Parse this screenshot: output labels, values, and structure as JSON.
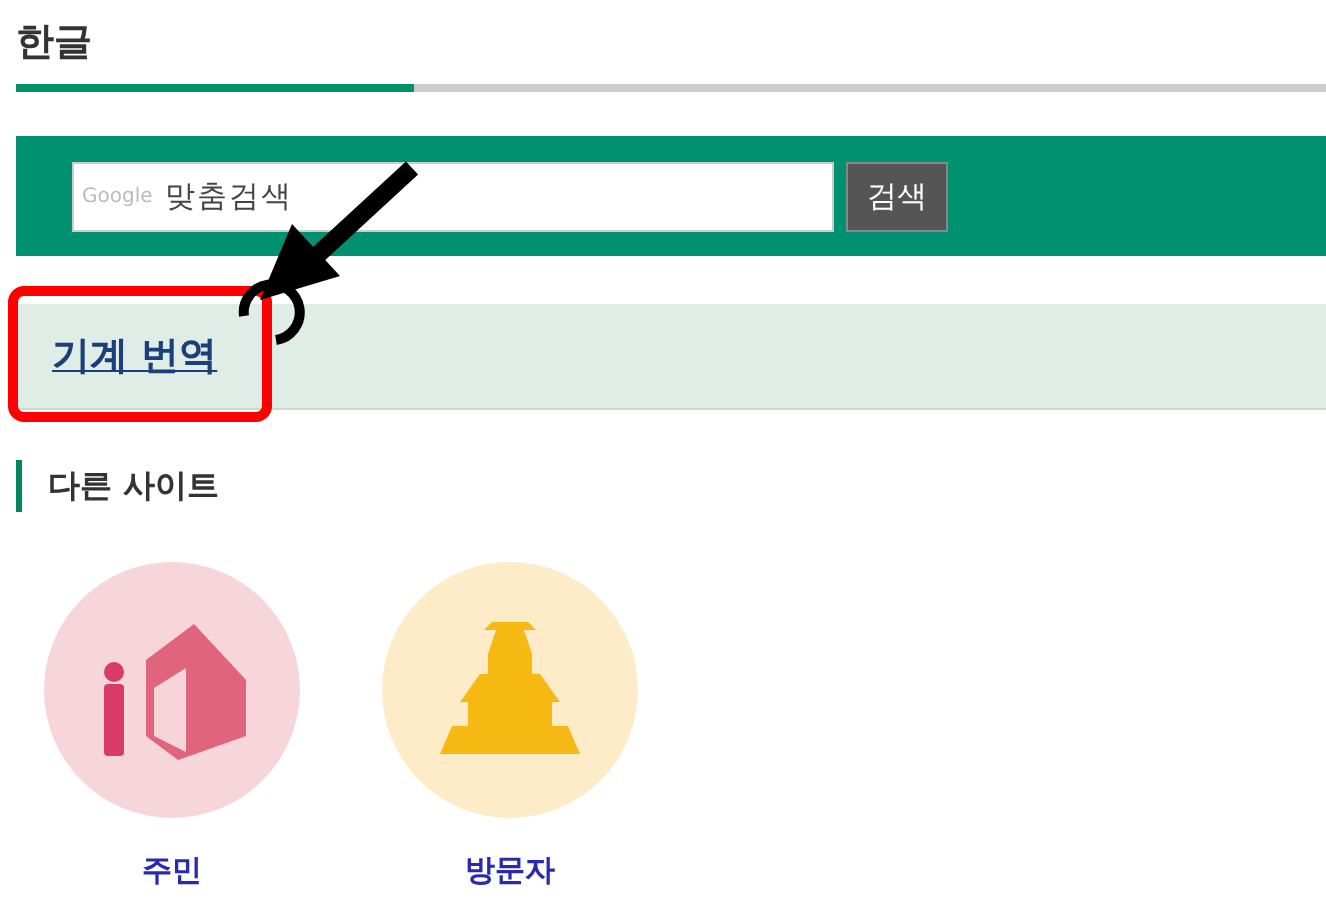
{
  "page_title": "한글",
  "tabs": [
    {
      "selected": true
    }
  ],
  "search": {
    "logo": "Google",
    "placeholder": "맞춤검색",
    "button": "검색"
  },
  "translate_link": "기계 번역",
  "section_title": "다른 사이트",
  "sites": [
    {
      "kind": "resident",
      "label": "주민"
    },
    {
      "kind": "visitor",
      "label": "방문자"
    }
  ]
}
